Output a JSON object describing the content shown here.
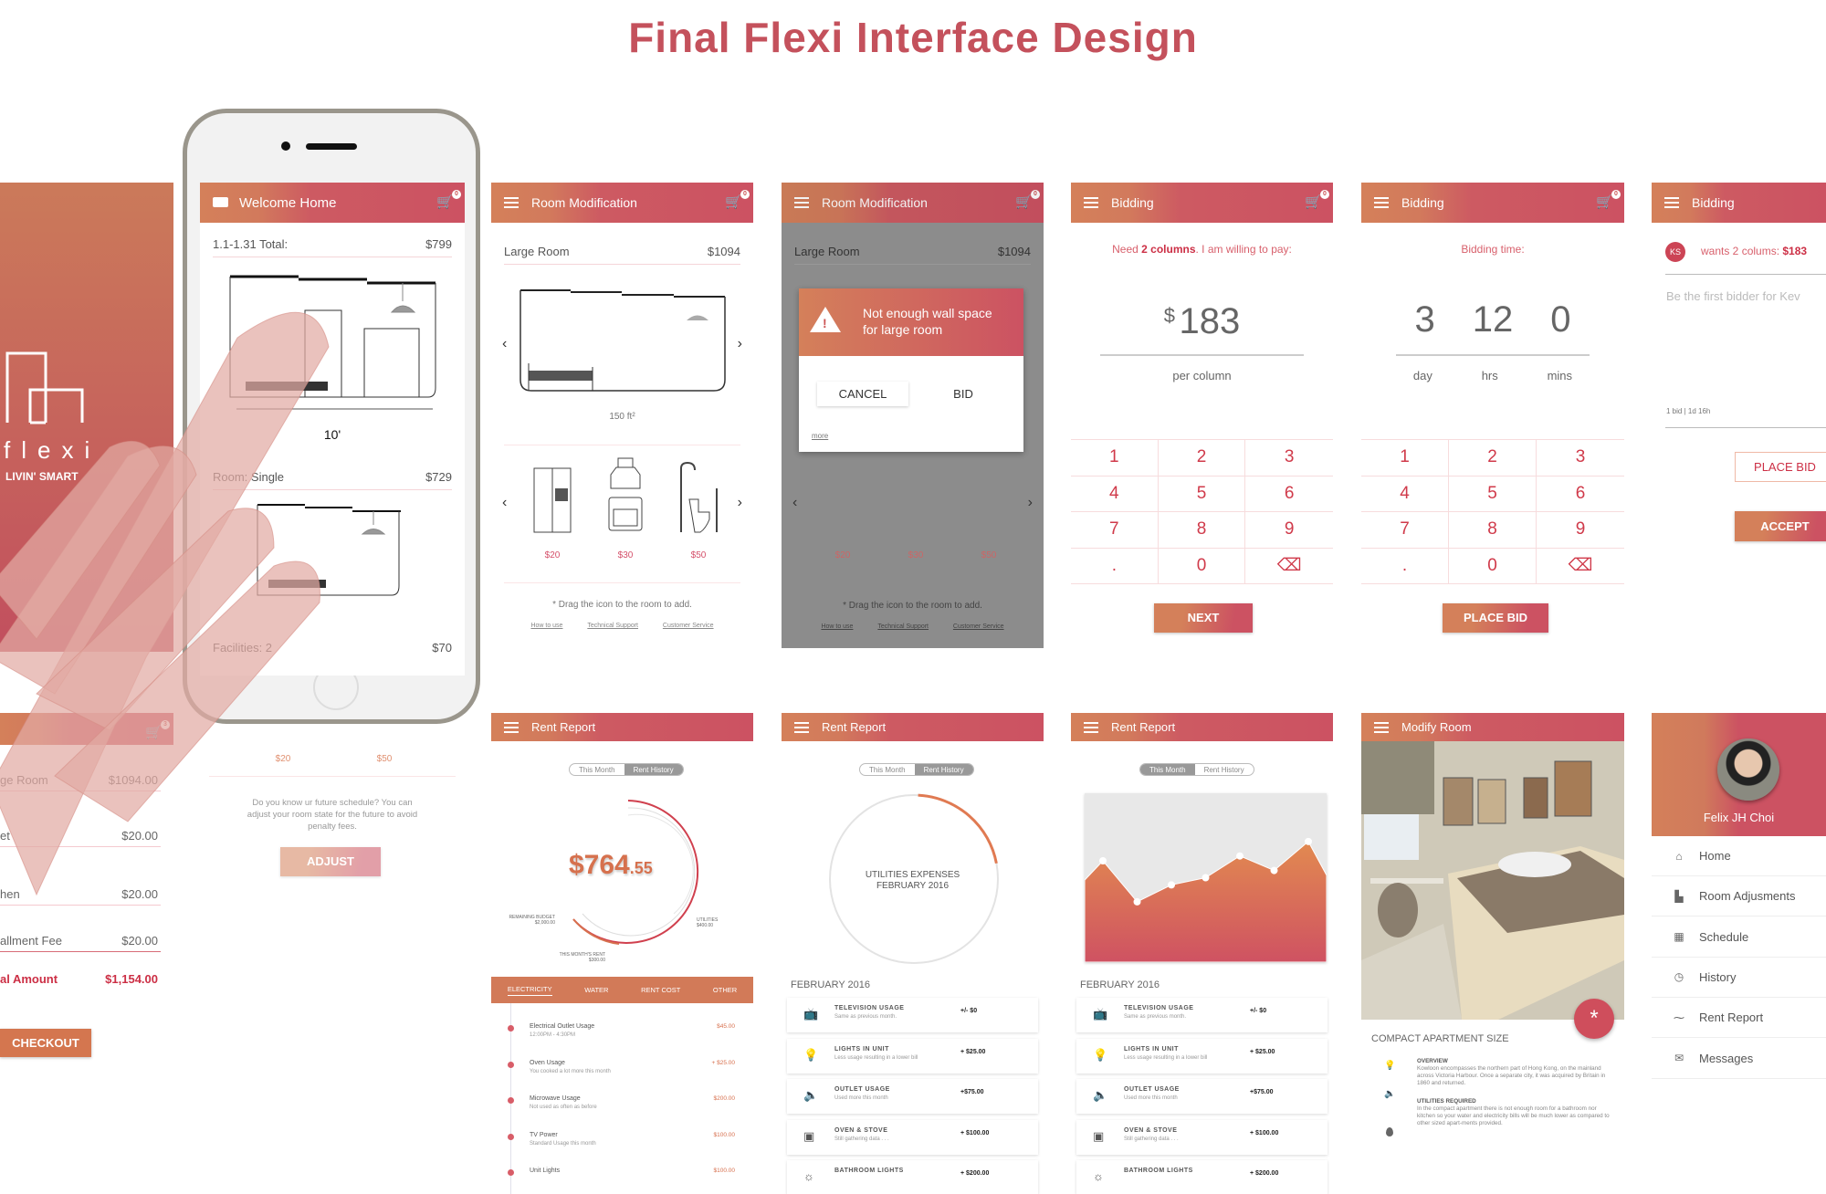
{
  "page_title": "Final Flexi Interface Design",
  "colors": {
    "brand_red": "#cc5262",
    "brand_orange": "#d4805a",
    "title": "#c4515c",
    "keypad_text": "#d03a4a"
  },
  "splash": {
    "wordmark": "flexi",
    "tagline": "LIVIN' SMART"
  },
  "welcome": {
    "title": "Welcome Home",
    "cart_count": "0",
    "total_label": "1.1-1.31 Total:",
    "total_value": "$799",
    "width_label": "10'",
    "room_label": "Room: Single",
    "room_value": "$729",
    "facilities_label": "Facilities: 2",
    "facilities_value": "$70",
    "prices": [
      "$20",
      "$50"
    ],
    "note": "Do you know ur future schedule? You can adjust your room state for the future to avoid penalty fees.",
    "adjust": "ADJUST"
  },
  "room_mod": {
    "title": "Room Modification",
    "cart_count": "0",
    "room_label": "Large Room",
    "room_value": "$1094",
    "area": "150 ft²",
    "prices": [
      "$20",
      "$30",
      "$50"
    ],
    "hint": "* Drag the icon to the room to add.",
    "links": [
      "How to use",
      "Technical Support",
      "Customer Service"
    ]
  },
  "room_mod_alert": {
    "message": "Not enough wall space for large room",
    "cancel": "CANCEL",
    "bid": "BID",
    "more": "more"
  },
  "bid_amount": {
    "title": "Bidding",
    "cart_count": "0",
    "prompt_a": "Need ",
    "prompt_b": "2 columns",
    "prompt_c": ". I am willing to pay:",
    "currency": "$",
    "amount": "183",
    "unit": "per column",
    "keys": [
      "1",
      "2",
      "3",
      "4",
      "5",
      "6",
      "7",
      "8",
      "9",
      ".",
      "0",
      "⌫"
    ],
    "next": "NEXT"
  },
  "bid_time": {
    "title": "Bidding",
    "cart_count": "0",
    "prompt": "Bidding time:",
    "values": [
      "3",
      "12",
      "0"
    ],
    "units": [
      "day",
      "hrs",
      "mins"
    ],
    "place_bid": "PLACE BID"
  },
  "bid_offer": {
    "title": "Bidding",
    "initials": "KS",
    "request": "wants 2 colums: ",
    "request_price": "$183",
    "placeholder": "Be the first bidder for Kev",
    "meta": "1 bid | 1d 16h",
    "place_bid": "PLACE BID",
    "accept": "ACCEPT"
  },
  "checkout": {
    "cart_count": "3",
    "rows": [
      {
        "label": "ge Room",
        "value": "$1094.00"
      },
      {
        "label": "et",
        "value": "$20.00"
      },
      {
        "label": "hen",
        "value": "$20.00"
      },
      {
        "label": "allment Fee",
        "value": "$20.00"
      }
    ],
    "total_label": "al Amount",
    "total_value": "$1,154.00",
    "button": "CHECKOUT"
  },
  "rent1": {
    "title": "Rent Report",
    "toggle": [
      "This Month",
      "Rent History"
    ],
    "active_toggle": 0,
    "amount_main": "$764",
    "amount_cents": ".55",
    "labels": [
      {
        "name": "REMAINING BUDGET",
        "value": "$2,000.00"
      },
      {
        "name": "UTILITIES",
        "value": "$400.00"
      },
      {
        "name": "THIS MONTH'S RENT",
        "value": "$300.00"
      }
    ],
    "tabs": [
      "ELECTRICITY",
      "WATER",
      "RENT COST",
      "OTHER"
    ],
    "active_tab": 0,
    "items": [
      {
        "title": "Electrical Outlet Usage",
        "sub": "12:00PM - 4:30PM",
        "value": "$45.00"
      },
      {
        "title": "Oven Usage",
        "sub": "You cooked a lot more this month",
        "value": "+ $25.00"
      },
      {
        "title": "Microwave Usage",
        "sub": "Not used as often as before",
        "value": "$200.00"
      },
      {
        "title": "TV Power",
        "sub": "Standard Usage this month",
        "value": "$100.00"
      },
      {
        "title": "Unit Lights",
        "sub": "",
        "value": "$100.00"
      }
    ]
  },
  "rent2": {
    "title": "Rent Report",
    "toggle": [
      "This Month",
      "Rent History"
    ],
    "center_line1": "UTILITIES EXPENSES",
    "center_line2": "FEBRUARY 2016",
    "progress": 0.22,
    "month": "FEBRUARY 2016",
    "cards": [
      {
        "icon": "tv-icon",
        "title": "TELEVISION USAGE",
        "sub": "Same as previous month.",
        "value": "+/- $0"
      },
      {
        "icon": "lightbulb-icon",
        "title": "LIGHTS IN UNIT",
        "sub": "Less usage resulting in a lower bill",
        "value": "+ $25.00"
      },
      {
        "icon": "speaker-icon",
        "title": "OUTLET USAGE",
        "sub": "Used more this month",
        "value": "+$75.00"
      },
      {
        "icon": "oven-icon",
        "title": "OVEN & STOVE",
        "sub": "Still gathering data . . .",
        "value": "+ $100.00"
      },
      {
        "icon": "sun-icon",
        "title": "BATHROOM LIGHTS",
        "sub": "",
        "value": "+ $200.00"
      }
    ]
  },
  "rent3": {
    "title": "Rent Report",
    "toggle": [
      "This Month",
      "Rent History"
    ],
    "trend": [
      62,
      45,
      52,
      55,
      64,
      58,
      70
    ],
    "month": "FEBRUARY 2016"
  },
  "modify": {
    "title": "Modify Room",
    "heading": "COMPACT APARTMENT SIZE",
    "sections": [
      {
        "title": "OVERVIEW",
        "body": "Kowloon encompasses the northern part of Hong Kong, on the mainland across Victoria Harbour. Once a separate city, it was acquired by Britain in 1860 and returned."
      },
      {
        "title": "UTILITIES REQUIRED",
        "body": "In the compact apartment there is not enough room for a bathroom nor kitchen so your water and electricity bills will be much lower as compared to other sized apart-ments provided."
      }
    ]
  },
  "drawer": {
    "user": "Felix JH Choi",
    "items": [
      {
        "icon": "home-icon",
        "glyph": "⌂",
        "label": "Home"
      },
      {
        "icon": "room-icon",
        "glyph": "▙",
        "label": "Room Adjusments"
      },
      {
        "icon": "calendar-icon",
        "glyph": "▦",
        "label": "Schedule"
      },
      {
        "icon": "history-icon",
        "glyph": "◷",
        "label": "History"
      },
      {
        "icon": "chart-icon",
        "glyph": "⁓",
        "label": "Rent Report"
      },
      {
        "icon": "mail-icon",
        "glyph": "✉",
        "label": "Messages"
      }
    ]
  }
}
